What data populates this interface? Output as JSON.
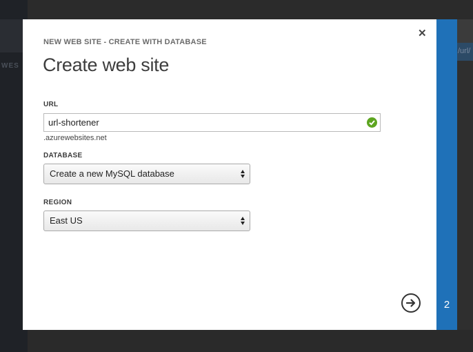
{
  "background": {
    "left_nav_text": "WES",
    "right_text": "/url/"
  },
  "dialog": {
    "subtitle": "NEW WEB SITE - CREATE WITH DATABASE",
    "title": "Create web site",
    "close_icon": "close-icon",
    "fields": {
      "url": {
        "label": "URL",
        "value": "url-shortener",
        "suffix": ".azurewebsites.net",
        "valid_icon": "check-circle-icon"
      },
      "database": {
        "label": "DATABASE",
        "selected": "Create a new MySQL database"
      },
      "region": {
        "label": "REGION",
        "selected": "East US"
      }
    },
    "next_icon": "arrow-right-circle-icon",
    "step": "2"
  },
  "colors": {
    "accent": "#1f71b8",
    "valid": "#5da520"
  }
}
